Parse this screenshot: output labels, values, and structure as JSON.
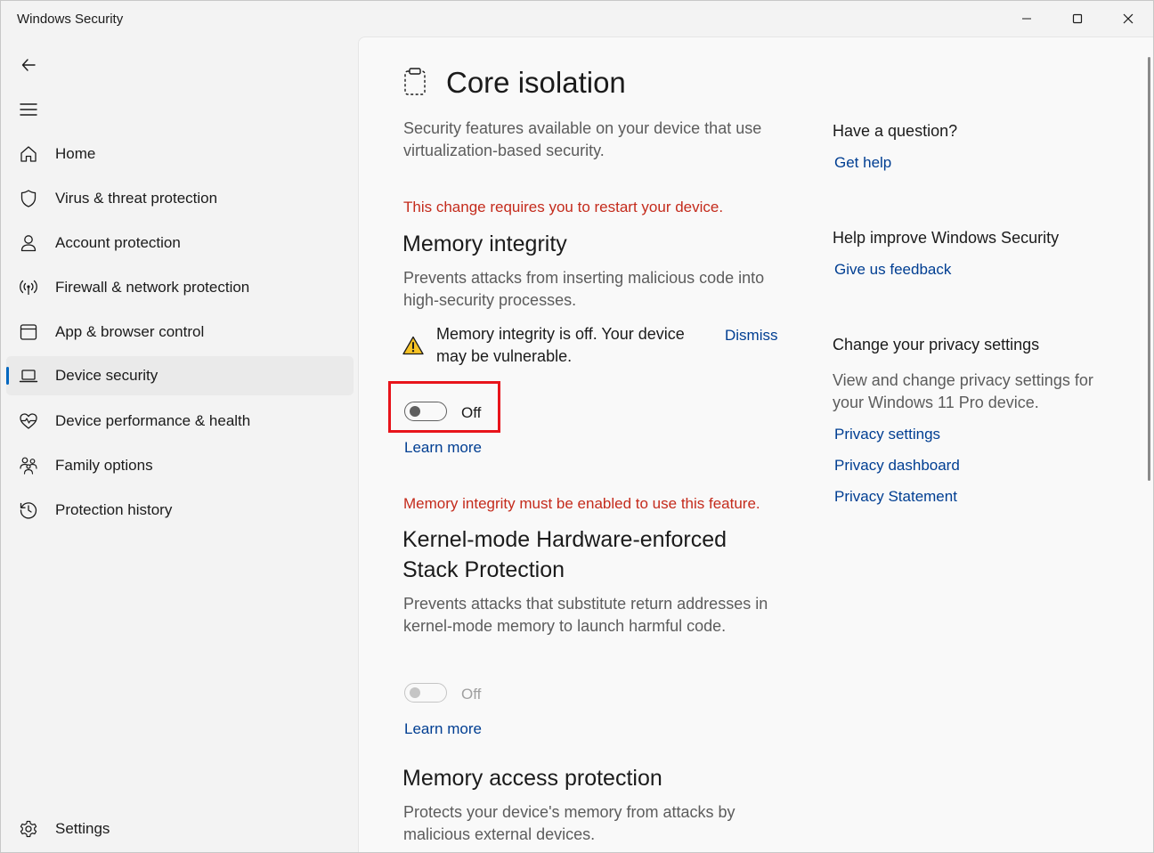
{
  "window": {
    "title": "Windows Security"
  },
  "sidebar": {
    "back_icon": "back-arrow-icon",
    "menu_icon": "hamburger-menu-icon",
    "items": [
      {
        "label": "Home",
        "icon": "home-icon"
      },
      {
        "label": "Virus & threat protection",
        "icon": "shield-icon"
      },
      {
        "label": "Account protection",
        "icon": "person-icon"
      },
      {
        "label": "Firewall & network protection",
        "icon": "wireless-signal-icon"
      },
      {
        "label": "App & browser control",
        "icon": "app-window-icon"
      },
      {
        "label": "Device security",
        "icon": "laptop-icon",
        "selected": true
      },
      {
        "label": "Device performance & health",
        "icon": "heart-pulse-icon"
      },
      {
        "label": "Family options",
        "icon": "family-icon"
      },
      {
        "label": "Protection history",
        "icon": "history-clock-icon"
      }
    ],
    "settings": {
      "label": "Settings",
      "icon": "gear-icon"
    }
  },
  "main": {
    "title": "Core isolation",
    "description": "Security features available on your device that use virtualization-based security.",
    "restart_notice": "This change requires you to restart your device.",
    "memory_integrity": {
      "heading": "Memory integrity",
      "description": "Prevents attacks from inserting malicious code into high-security processes.",
      "warning": "Memory integrity is off. Your device may be vulnerable.",
      "dismiss": "Dismiss",
      "toggle_state": "Off",
      "toggle_on": false,
      "learn_more": "Learn more"
    },
    "requirement_notice": "Memory integrity must be enabled to use this feature.",
    "kernel_stack": {
      "heading": "Kernel-mode Hardware-enforced Stack Protection",
      "description": "Prevents attacks that substitute return addresses in kernel-mode memory to launch harmful code.",
      "toggle_state": "Off",
      "toggle_on": false,
      "toggle_enabled": false,
      "learn_more": "Learn more"
    },
    "memory_access": {
      "heading": "Memory access protection",
      "description": "Protects your device's memory from attacks by malicious external devices."
    }
  },
  "right_panel": {
    "question_heading": "Have a question?",
    "get_help": "Get help",
    "improve_heading": "Help improve Windows Security",
    "feedback": "Give us feedback",
    "privacy_heading": "Change your privacy settings",
    "privacy_description": "View and change privacy settings for your Windows 11 Pro device.",
    "privacy_settings": "Privacy settings",
    "privacy_dashboard": "Privacy dashboard",
    "privacy_statement": "Privacy Statement"
  },
  "colors": {
    "accent": "#0067c0",
    "link": "#003e92",
    "error": "#c42b1c",
    "highlight": "#e8141b",
    "warning": "#f7c325"
  }
}
